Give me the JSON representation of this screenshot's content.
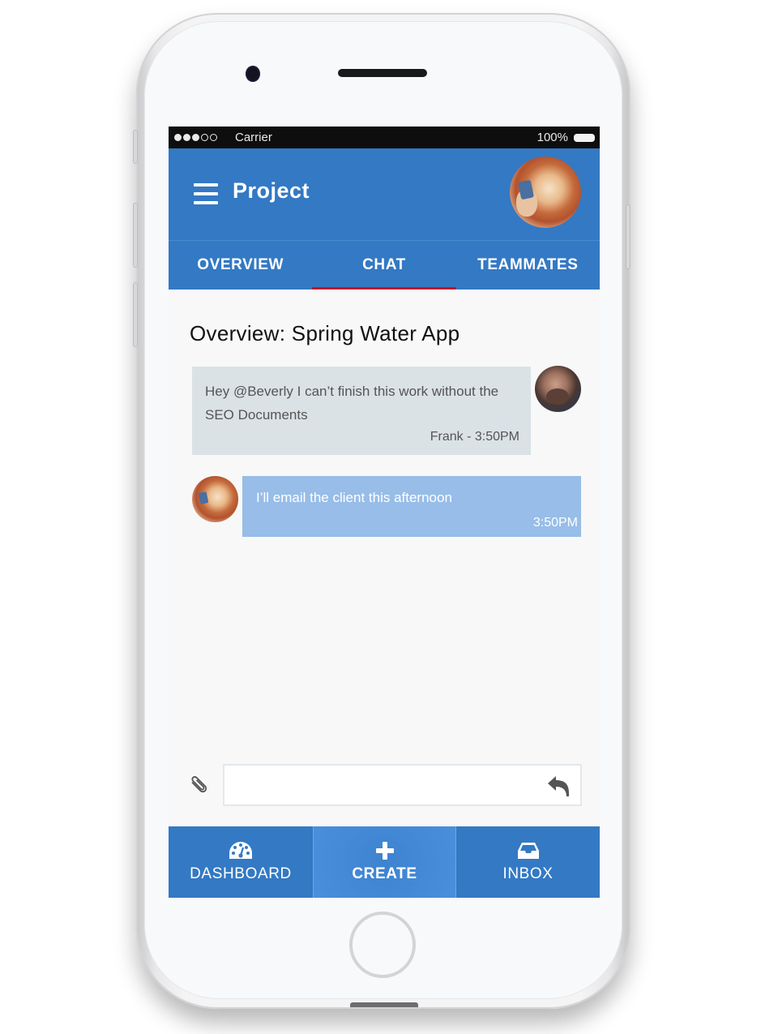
{
  "status_bar": {
    "signal_strength": "3 of 5",
    "carrier": "Carrier",
    "battery_percent": "100%"
  },
  "header": {
    "menu_icon": "hamburger-menu-icon",
    "title": "Project",
    "avatar": "user-avatar-beverly"
  },
  "tabs": [
    {
      "label": "OVERVIEW",
      "active": false
    },
    {
      "label": "CHAT",
      "active": true
    },
    {
      "label": "TEAMMATES",
      "active": false
    }
  ],
  "content": {
    "title": "Overview: Spring Water App"
  },
  "messages": [
    {
      "direction": "incoming",
      "text": "Hey @Beverly I can’t finish this work without the SEO Documents",
      "meta": "Frank - 3:50PM",
      "avatar": "avatar-frank"
    },
    {
      "direction": "outgoing",
      "text": "I’ll email the client this afternoon",
      "meta": "3:50PM",
      "avatar": "avatar-beverly"
    }
  ],
  "composer": {
    "value": "",
    "placeholder": "",
    "attach_icon": "paperclip-icon",
    "send_icon": "reply-arrow-icon"
  },
  "bottom_nav": [
    {
      "label": "DASHBOARD",
      "icon": "dashboard-gauge-icon"
    },
    {
      "label": "CREATE",
      "icon": "plus-icon"
    },
    {
      "label": "INBOX",
      "icon": "inbox-tray-icon"
    }
  ],
  "colors": {
    "primary": "#3379c4",
    "active_tab_indicator": "#c0172b",
    "incoming_bubble": "#dae2e6",
    "outgoing_bubble": "#97bde8",
    "status_bar": "#0e0e0e"
  }
}
